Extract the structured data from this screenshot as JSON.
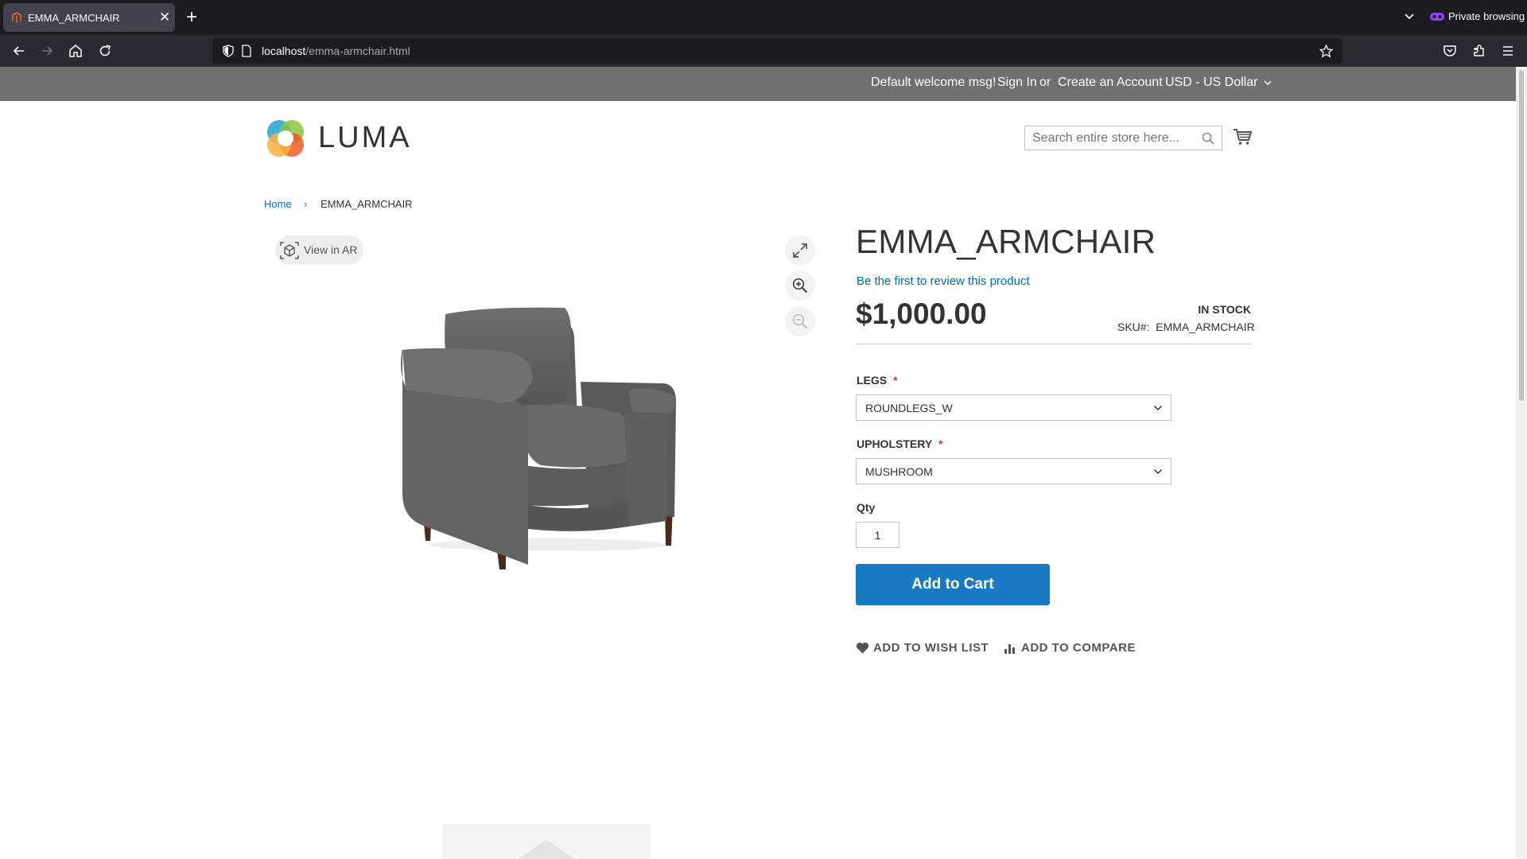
{
  "browser": {
    "tab_title": "EMMA_ARMCHAIR",
    "close_glyph": "✕",
    "new_tab_glyph": "+",
    "private_label": "Private browsing",
    "url_host": "localhost",
    "url_path": "/emma-armchair.html"
  },
  "header_panel": {
    "welcome": "Default welcome msg!",
    "sign_in": "Sign In",
    "or": "or",
    "create_account": "Create an Account",
    "currency": "USD - US Dollar"
  },
  "header": {
    "logo_text": "LUMA",
    "search_placeholder": "Search entire store here..."
  },
  "breadcrumb": {
    "home": "Home",
    "separator": "›",
    "current": "EMMA_ARMCHAIR"
  },
  "gallery": {
    "view_ar": "View in AR"
  },
  "product": {
    "name": "EMMA_ARMCHAIR",
    "review_link": "Be the first to review this product",
    "price": "$1,000.00",
    "stock": "IN STOCK",
    "sku_label": "SKU#:",
    "sku": "EMMA_ARMCHAIR",
    "legs_label": "LEGS",
    "legs_value": "ROUNDLEGS_W",
    "upholstery_label": "UPHOLSTERY",
    "upholstery_value": "MUSHROOM",
    "required_mark": "*",
    "qty_label": "Qty",
    "qty_value": "1",
    "add_to_cart": "Add to Cart",
    "wish_list": "ADD TO WISH LIST",
    "compare": "ADD TO COMPARE"
  },
  "colors": {
    "accent": "#1979c3",
    "link": "#006bb4",
    "panel": "#6e716e",
    "required": "#e02b27"
  },
  "icons": [
    "magento-favicon",
    "close-icon",
    "plus-icon",
    "chevron-down-icon",
    "private-mask-icon",
    "back-icon",
    "forward-icon",
    "home-icon",
    "reload-icon",
    "shield-icon",
    "page-icon",
    "star-icon",
    "pocket-icon",
    "extensions-icon",
    "menu-icon",
    "search-icon",
    "cart-icon",
    "ar-cube-icon",
    "fullscreen-icon",
    "zoom-in-icon",
    "zoom-out-icon",
    "heart-icon",
    "compare-icon"
  ]
}
